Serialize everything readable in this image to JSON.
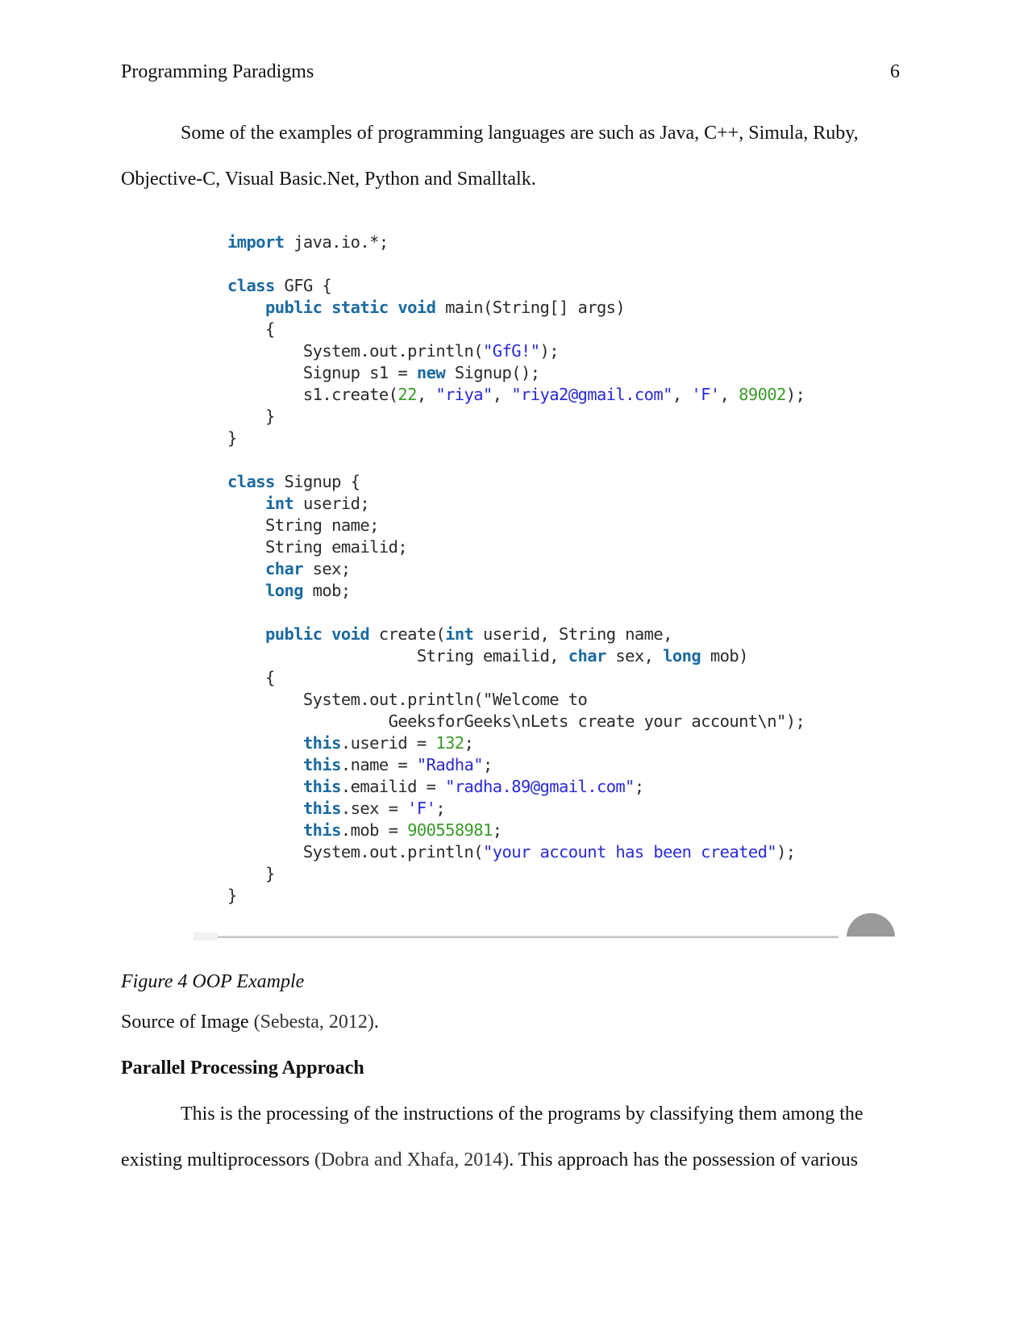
{
  "header": {
    "title": "Programming Paradigms",
    "page_number": "6"
  },
  "paragraph1": {
    "line1": "Some of the examples of programming languages are such as Java, C++, Simula, Ruby,",
    "line2": "Objective-C, Visual Basic.Net, Python and Smalltalk."
  },
  "figure": {
    "code_lines": [
      [
        [
          "kw",
          "import"
        ],
        [
          "t",
          " java.io.*;"
        ]
      ],
      [],
      [
        [
          "kw",
          "class"
        ],
        [
          "t",
          " GFG {"
        ]
      ],
      [
        [
          "t",
          "    "
        ],
        [
          "kw",
          "public static void"
        ],
        [
          "t",
          " main(String[] args)"
        ]
      ],
      [
        [
          "t",
          "    {"
        ]
      ],
      [
        [
          "t",
          "        System.out.println("
        ],
        [
          "str",
          "\"GfG!\""
        ],
        [
          "t",
          ");"
        ]
      ],
      [
        [
          "t",
          "        Signup s1 = "
        ],
        [
          "kw",
          "new"
        ],
        [
          "t",
          " Signup();"
        ]
      ],
      [
        [
          "t",
          "        s1.create("
        ],
        [
          "num",
          "22"
        ],
        [
          "t",
          ", "
        ],
        [
          "str",
          "\"riya\""
        ],
        [
          "t",
          ", "
        ],
        [
          "str",
          "\"riya2@gmail.com\""
        ],
        [
          "t",
          ", "
        ],
        [
          "str",
          "'F'"
        ],
        [
          "t",
          ", "
        ],
        [
          "num",
          "89002"
        ],
        [
          "t",
          ");"
        ]
      ],
      [
        [
          "t",
          "    }"
        ]
      ],
      [
        [
          "t",
          "}"
        ]
      ],
      [],
      [
        [
          "kw",
          "class"
        ],
        [
          "t",
          " Signup {"
        ]
      ],
      [
        [
          "t",
          "    "
        ],
        [
          "kw",
          "int"
        ],
        [
          "t",
          " userid;"
        ]
      ],
      [
        [
          "t",
          "    String name;"
        ]
      ],
      [
        [
          "t",
          "    String emailid;"
        ]
      ],
      [
        [
          "t",
          "    "
        ],
        [
          "kw",
          "char"
        ],
        [
          "t",
          " sex;"
        ]
      ],
      [
        [
          "t",
          "    "
        ],
        [
          "kw",
          "long"
        ],
        [
          "t",
          " mob;"
        ]
      ],
      [],
      [
        [
          "t",
          "    "
        ],
        [
          "kw",
          "public void"
        ],
        [
          "t",
          " create("
        ],
        [
          "kw",
          "int"
        ],
        [
          "t",
          " userid, String name,"
        ]
      ],
      [
        [
          "t",
          "                    String emailid, "
        ],
        [
          "kw",
          "char"
        ],
        [
          "t",
          " sex, "
        ],
        [
          "kw",
          "long"
        ],
        [
          "t",
          " mob)"
        ]
      ],
      [
        [
          "t",
          "    {"
        ]
      ],
      [
        [
          "t",
          "        System.out.println(\"Welcome to"
        ]
      ],
      [
        [
          "t",
          "                 GeeksforGeeks\\nLets create your account\\n\");"
        ]
      ],
      [
        [
          "t",
          "        "
        ],
        [
          "kw",
          "this"
        ],
        [
          "t",
          ".userid = "
        ],
        [
          "num",
          "132"
        ],
        [
          "t",
          ";"
        ]
      ],
      [
        [
          "t",
          "        "
        ],
        [
          "kw",
          "this"
        ],
        [
          "t",
          ".name = "
        ],
        [
          "str",
          "\"Radha\""
        ],
        [
          "t",
          ";"
        ]
      ],
      [
        [
          "t",
          "        "
        ],
        [
          "kw",
          "this"
        ],
        [
          "t",
          ".emailid = "
        ],
        [
          "str",
          "\"radha.89@gmail.com\""
        ],
        [
          "t",
          ";"
        ]
      ],
      [
        [
          "t",
          "        "
        ],
        [
          "kw",
          "this"
        ],
        [
          "t",
          ".sex = "
        ],
        [
          "str",
          "'F'"
        ],
        [
          "t",
          ";"
        ]
      ],
      [
        [
          "t",
          "        "
        ],
        [
          "kw",
          "this"
        ],
        [
          "t",
          ".mob = "
        ],
        [
          "num",
          "900558981"
        ],
        [
          "t",
          ";"
        ]
      ],
      [
        [
          "t",
          "        System.out.println("
        ],
        [
          "str",
          "\"your account has been created\""
        ],
        [
          "t",
          ");"
        ]
      ],
      [
        [
          "t",
          "    }"
        ]
      ],
      [
        [
          "t",
          "}"
        ]
      ]
    ],
    "colors": {
      "keyword": "#1b6aa0",
      "string": "#2a2ad6",
      "number": "#3a9a2a",
      "text": "#2b2b2b"
    },
    "caption": "Figure 4 OOP Example"
  },
  "source": {
    "label": "Source of Image ",
    "citation": "(Sebesta, 2012)",
    "end": "."
  },
  "section": {
    "heading": "Parallel Processing Approach",
    "line1": "This is the processing of the instructions of the programs by classifying them among the",
    "line2_pre": "existing multiprocessors ",
    "line2_cite": "(Dobra and Xhafa, 2014)",
    "line2_post": ". This approach has the possession of various"
  }
}
